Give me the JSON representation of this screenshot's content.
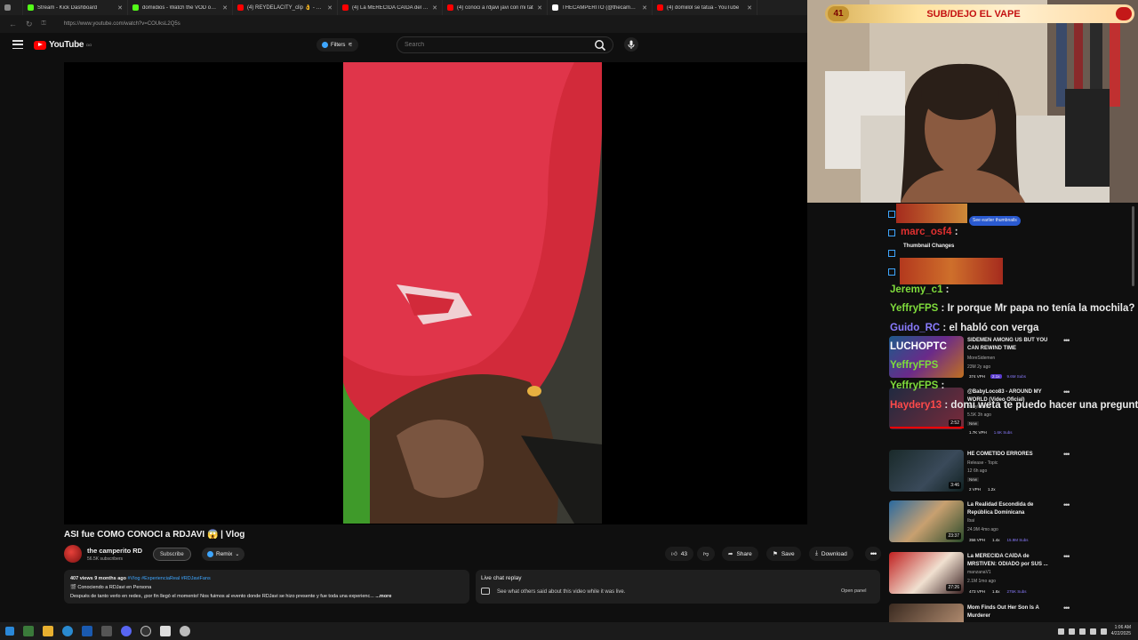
{
  "browser": {
    "tabs": [
      {
        "title": "Stream - Kick Dashboard",
        "color": "#53fc18"
      },
      {
        "title": "domiidios - Watch the VOD on Ki",
        "color": "#53fc18"
      },
      {
        "title": "(4) REYDELACITY_clip 👌 - YouTu",
        "color": "#ff0000"
      },
      {
        "title": "(4) La MERECIDA CAÍDA del PAD",
        "color": "#ff0000"
      },
      {
        "title": "(4) conoci a rdjavi javi con mi tat",
        "color": "#ff0000"
      },
      {
        "title": "THECAMPERITO (@thecamperito",
        "color": "#ffffff"
      },
      {
        "title": "(4) domiilol se tatua - YouTube",
        "color": "#ff0000"
      }
    ],
    "url": "https://www.youtube.com/watch?v=COUksL2Q5s"
  },
  "header": {
    "logo_text": "YouTube",
    "logo_sup": "DO",
    "filters_label": "Filters",
    "search_placeholder": "Search"
  },
  "video": {
    "title": "ASI fue COMO CONOCI a RDJAVI 😱 | Vlog",
    "channel": "the camperito RD",
    "subscribers": "56.5K subscribers",
    "subscribe_label": "Subscribe",
    "remix_label": "Remix",
    "likes": "43",
    "share_label": "Share",
    "save_label": "Save",
    "download_label": "Download",
    "more_label": "•••"
  },
  "description": {
    "stats": "407 views  9 months ago",
    "tags": "#Vlog #ExperienciaReal #RDJaviFans",
    "line1": "🎬 Conociendo a RDJavi en Persona",
    "line2": "Después de tanto verlo en redes, ¡por fin llegó el momento! Nos fuimos al evento donde RDJavi se hizo presente y fue toda una experienc...",
    "more": "...more"
  },
  "live_chat": {
    "title": "Live chat replay",
    "desc": "See what others said about this video while it was live.",
    "open_panel": "Open panel"
  },
  "webcam": {
    "banner_num": "41",
    "banner_text": "SUB/DEJO EL VAPE"
  },
  "chat": [
    {
      "user": "marc_osf4",
      "msg": ""
    },
    {
      "user": "Jeremy_c1",
      "msg": ""
    },
    {
      "user": "YeffryFPS",
      "msg": "Ir porque Mr papa no tenía la mochila?"
    },
    {
      "user": "Guido_RC",
      "msg": "el habló con verga"
    },
    {
      "user": "LUCHOPTC",
      "msg": ""
    },
    {
      "user": "YeffryFPS",
      "msg": ""
    },
    {
      "user": "YeffryFPS",
      "msg": ""
    },
    {
      "user": "Haydery13",
      "msg": "domi weta te puedo hacer una pregunta"
    }
  ],
  "chat_overlay": {
    "see_thumbnails": "See earlier thumbnails",
    "thumbnail_changes": "Thumbnail Changes"
  },
  "sidebar": [
    {
      "title": "SIDEMEN AMONG US BUT YOU CAN REWIND TIME",
      "channel": "MoreSidemen",
      "meta": "23M  2y ago",
      "stats": [
        "374 VPH",
        "2.1x",
        "9.6M Subs"
      ],
      "duration": ""
    },
    {
      "title": "@BabyLoco83 - AROUND MY WORLD (Video Oficial)",
      "channel": "Babyloco83",
      "meta": "5.5K  3h ago",
      "new": "New",
      "stats": [
        "1.7K VPH",
        "1.6K Subs"
      ],
      "duration": "2:52"
    },
    {
      "title": "HE COMETIDO ERRORES",
      "channel": "Release - Topic",
      "meta": "12  6h ago",
      "new": "New",
      "stats": [
        "2 VPH",
        "1.2x"
      ],
      "duration": "3:46"
    },
    {
      "title": "La Realidad Escondida de República Dominicana",
      "channel": "Ibai",
      "meta": "24.9M  4mo ago",
      "stats": [
        "356 VPH",
        "1.4x",
        "15.9M Subs"
      ],
      "duration": "23:37"
    },
    {
      "title": "La MERECIDA CAÍDA de MRSTIVEN: ODIADO por SUS ...",
      "channel": "manzanaV1",
      "meta": "2.1M  1mo ago",
      "stats": [
        "473 VPH",
        "1.8x",
        "275K Subs"
      ],
      "duration": "27:26"
    },
    {
      "title": "Mom Finds Out Her Son Is A Murderer",
      "channel": "",
      "meta": "",
      "stats": [],
      "duration": ""
    }
  ],
  "taskbar": {
    "time": "1:06 AM",
    "date": "4/22/2025"
  }
}
